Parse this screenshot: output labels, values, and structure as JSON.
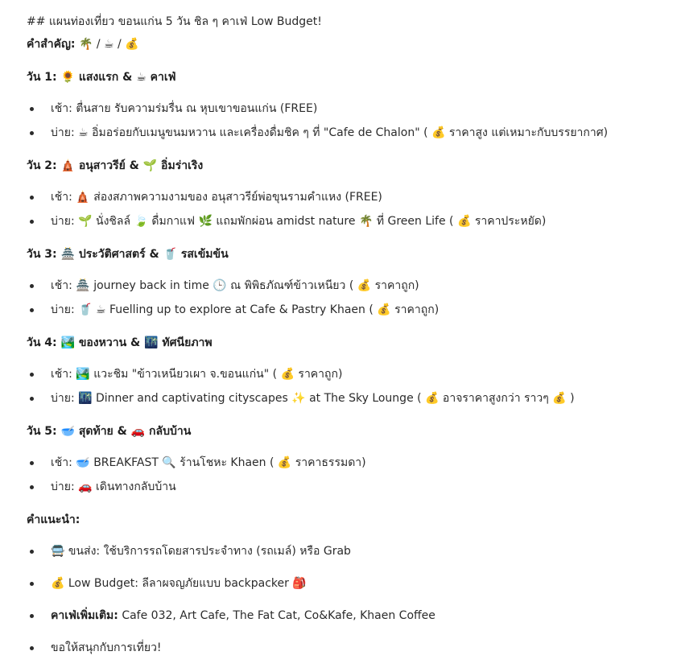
{
  "title": "## แผนท่องเที่ยว ขอนแก่น 5 วัน ชิล ๆ คาเฟ่ Low Budget!",
  "keywords": {
    "label": "คำสำคัญ:",
    "value": "🌴 / ☕ / 💰"
  },
  "days": [
    {
      "heading": "วัน 1: 🌻 แสงแรก & ☕ คาเฟ่",
      "items": [
        "เช้า: ตื่นสาย รับความร่มรื่น ณ หุบเขาขอนแก่น (FREE)",
        "บ่าย: ☕ อิ่มอร่อยกับเมนูขนมหวาน และเครื่องดื่มชิค ๆ ที่ \"Cafe de Chalon\" ( 💰 ราคาสูง แต่เหมาะกับบรรยากาศ)"
      ]
    },
    {
      "heading": "วัน 2: 🛕 อนุสาวรีย์ & 🌱 อิ่มร่าเริง",
      "items": [
        "เช้า: 🛕 ส่องสภาพความงามของ อนุสาวรีย์พ่อขุนรามคำแหง (FREE)",
        "บ่าย: 🌱 นั่งชิลล์ 🍃 ดื่มกาแฟ 🌿 แถมพักผ่อน amidst nature 🌴 ที่ Green Life ( 💰 ราคาประหยัด)"
      ]
    },
    {
      "heading": "วัน 3: 🏯 ประวัติศาสตร์ & 🥤 รสเข้มข้น",
      "items": [
        "เช้า: 🏯 journey back in time 🕒 ณ พิพิธภัณฑ์ข้าวเหนียว ( 💰 ราคาถูก)",
        "บ่าย: 🥤 ☕ Fuelling up to explore at Cafe & Pastry Khaen ( 💰 ราคาถูก)"
      ]
    },
    {
      "heading": "วัน 4: 🏞️ ของหวาน & 🌃 ทัศนียภาพ",
      "items": [
        "เช้า: 🏞️ แวะชิม \"ข้าวเหนียวเผา จ.ขอนแก่น\" ( 💰 ราคาถูก)",
        "บ่าย: 🌃 Dinner and captivating cityscapes ✨ at The Sky Lounge ( 💰 อาจราคาสูงกว่า ราวๆ 💰 )"
      ]
    },
    {
      "heading": "วัน 5: 🥣 สุดท้าย & 🚗 กลับบ้าน",
      "items": [
        "เช้า: 🥣 BREAKFAST 🔍 ร้านโชหะ Khaen ( 💰 ราคาธรรมดา)",
        "บ่าย: 🚗 เดินทางกลับบ้าน"
      ]
    }
  ],
  "tips": {
    "heading": "คำแนะนำ:",
    "transport": "🚍 ขนส่ง: ใช้บริการรถโดยสารประจำทาง (รถเมล์) หรือ Grab",
    "budget": "💰 Low Budget: ลีลาผจญภัยแบบ backpacker 🎒",
    "more_cafes_label": "คาเฟ่เพิ่มเติม:",
    "more_cafes_value": "Cafe 032, Art Cafe, The Fat Cat, Co&Kafe, Khaen Coffee",
    "closing": "ขอให้สนุกกับการเที่ยว!"
  }
}
